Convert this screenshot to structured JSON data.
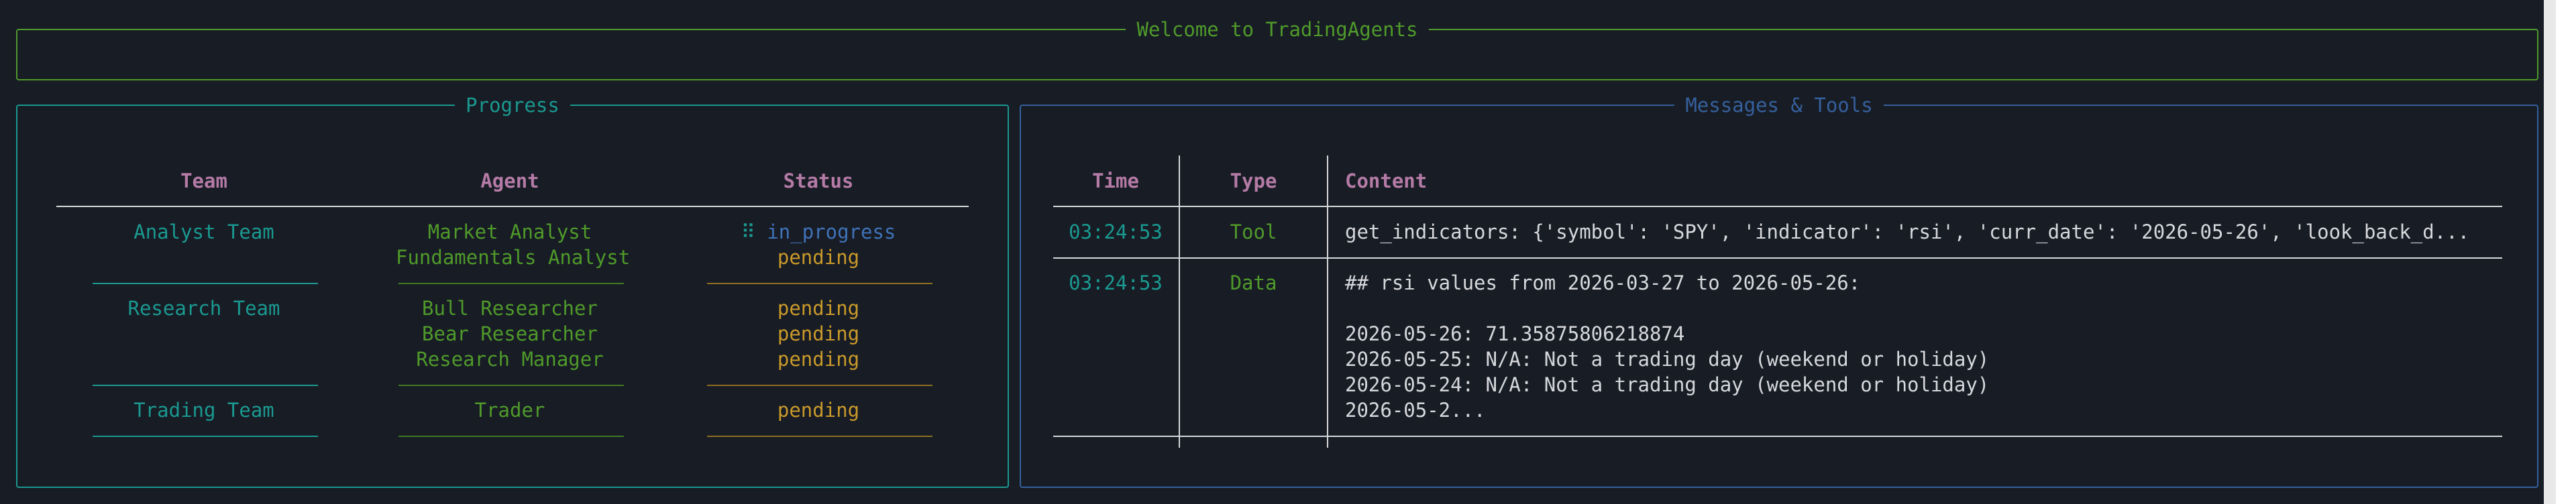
{
  "welcome": {
    "title": "Welcome to TradingAgents"
  },
  "progress": {
    "title": "Progress",
    "headers": {
      "team": "Team",
      "agent": "Agent",
      "status": "Status"
    },
    "groups": [
      {
        "team": "Analyst Team",
        "rows": [
          {
            "agent": "Market Analyst",
            "status_icon": "⠿",
            "status": "in_progress"
          },
          {
            "agent": "Fundamentals Analyst",
            "status": "pending"
          }
        ]
      },
      {
        "team": "Research Team",
        "rows": [
          {
            "agent": "Bull Researcher",
            "status": "pending"
          },
          {
            "agent": "Bear Researcher",
            "status": "pending"
          },
          {
            "agent": "Research Manager",
            "status": "pending"
          }
        ]
      },
      {
        "team": "Trading Team",
        "rows": [
          {
            "agent": "Trader",
            "status": "pending"
          }
        ]
      }
    ]
  },
  "messages": {
    "title": "Messages & Tools",
    "headers": {
      "time": "Time",
      "type": "Type",
      "content": "Content"
    },
    "rows": [
      {
        "time": "03:24:53",
        "type": "Tool",
        "content": "get_indicators: {'symbol': 'SPY', 'indicator': 'rsi', 'curr_date': '2026-05-26', 'look_back_d..."
      },
      {
        "time": "03:24:53",
        "type": "Data",
        "content_lines": [
          "## rsi values from 2026-03-27 to 2026-05-26:",
          "",
          "2026-05-26: 71.35875806218874",
          "2026-05-25: N/A: Not a trading day (weekend or holiday)",
          "2026-05-24: N/A: Not a trading day (weekend or holiday)",
          "2026-05-2..."
        ]
      }
    ]
  },
  "colors": {
    "background": "#181c25",
    "welcome_border": "#4f9a2a",
    "progress_border": "#1a9990",
    "messages_border": "#35609c",
    "header": "#b47ba6",
    "team": "#1a9990",
    "agent": "#4f9a2a",
    "pending": "#c99a2a",
    "in_progress": "#3f72b8"
  }
}
